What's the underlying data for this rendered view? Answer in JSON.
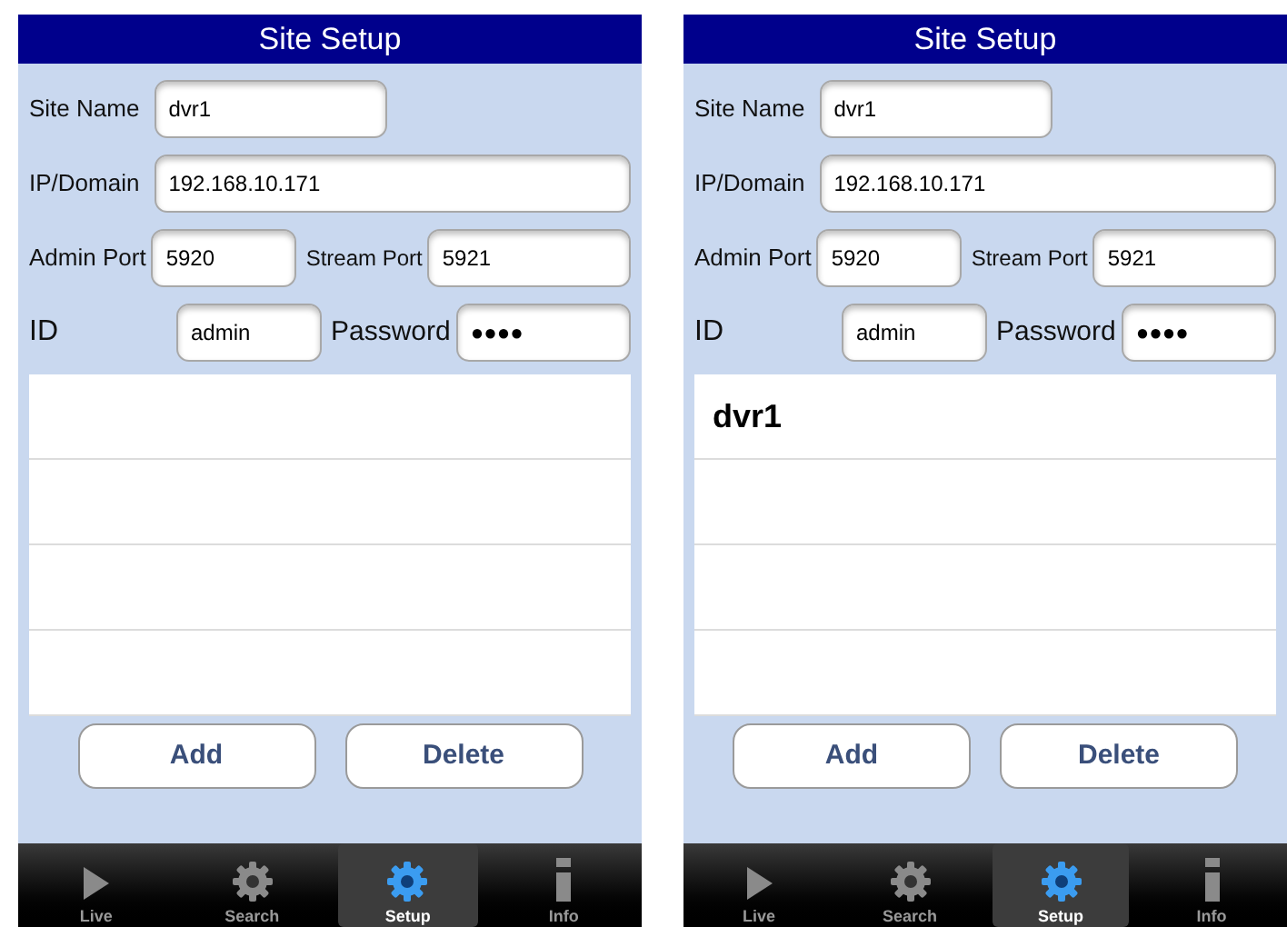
{
  "screens": [
    {
      "title": "Site Setup",
      "site_name": {
        "label": "Site Name",
        "value": "dvr1"
      },
      "ip": {
        "label": "IP/Domain",
        "value": "192.168.10.171"
      },
      "admin_port": {
        "label": "Admin Port",
        "value": "5920"
      },
      "stream_port": {
        "label": "Stream Port",
        "value": "5921"
      },
      "id": {
        "label": "ID",
        "value": "admin"
      },
      "password": {
        "label": "Password",
        "value": "●●●●"
      },
      "buttons": [
        "Add",
        "Delete"
      ],
      "tabs": [
        {
          "label": "Live",
          "kind": "play",
          "selected": false
        },
        {
          "label": "Search",
          "kind": "gear",
          "selected": false
        },
        {
          "label": "Setup",
          "kind": "gear",
          "selected": true
        },
        {
          "label": "Info",
          "kind": "info",
          "selected": false
        }
      ]
    },
    {
      "title": "Site Setup",
      "site_name": {
        "label": "Site Name",
        "value": "dvr1"
      },
      "ip": {
        "label": "IP/Domain",
        "value": "192.168.10.171"
      },
      "admin_port": {
        "label": "Admin Port",
        "value": "5920"
      },
      "stream_port": {
        "label": "Stream Port",
        "value": "5921"
      },
      "id": {
        "label": "ID",
        "value": "admin"
      },
      "password": {
        "label": "Password",
        "value": "●●●●"
      },
      "sites": [
        "dvr1"
      ],
      "buttons": [
        "Add",
        "Delete"
      ],
      "tabs": [
        {
          "label": "Live",
          "kind": "play",
          "selected": false
        },
        {
          "label": "Search",
          "kind": "gear",
          "selected": false
        },
        {
          "label": "Setup",
          "kind": "gear",
          "selected": true
        },
        {
          "label": "Info",
          "kind": "info",
          "selected": false
        }
      ]
    }
  ]
}
